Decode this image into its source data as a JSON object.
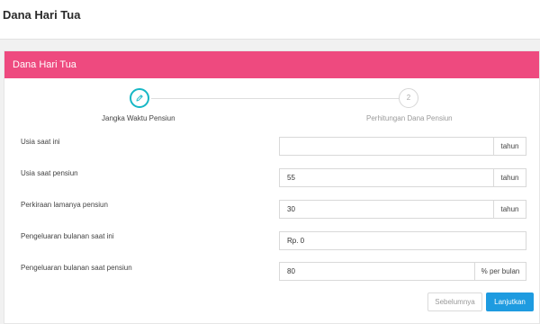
{
  "page": {
    "title": "Dana Hari Tua"
  },
  "card": {
    "title": "Dana Hari Tua"
  },
  "stepper": {
    "steps": [
      {
        "label": "Jangka Waktu Pensiun",
        "state": "active",
        "icon": "pencil-icon"
      },
      {
        "label": "Perhitungan Dana Pensiun",
        "state": "pending",
        "number": "2"
      }
    ]
  },
  "form": {
    "rows": [
      {
        "label": "Usia saat ini",
        "value": "",
        "suffix": "tahun"
      },
      {
        "label": "Usia saat pensiun",
        "value": "55",
        "suffix": "tahun"
      },
      {
        "label": "Perkiraan lamanya pensiun",
        "value": "30",
        "suffix": "tahun"
      },
      {
        "label": "Pengeluaran bulanan saat ini",
        "value": "Rp. 0",
        "suffix": ""
      },
      {
        "label": "Pengeluaran bulanan saat pensiun",
        "value": "80",
        "suffix": "% per bulan"
      }
    ]
  },
  "buttons": {
    "prev": "Sebelumnya",
    "next": "Lanjutkan"
  },
  "colors": {
    "header": "#ee4a7f",
    "primary": "#1e9be0",
    "step_active": "#16b7c5"
  }
}
